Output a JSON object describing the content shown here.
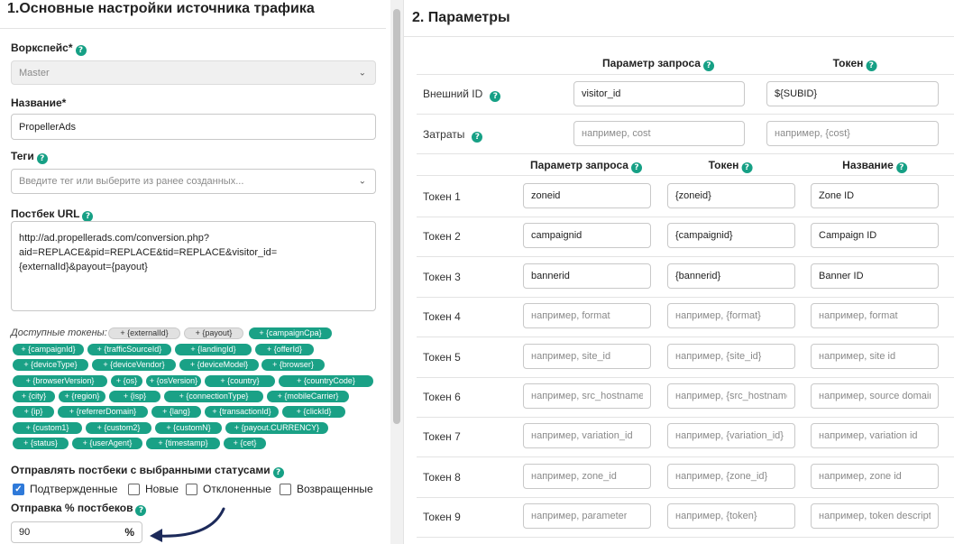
{
  "left": {
    "title": "1.Основные настройки источника трафика",
    "workspace": {
      "label": "Воркспейс*",
      "value": "Master"
    },
    "name": {
      "label": "Название*",
      "value": "PropellerAds"
    },
    "tags": {
      "label": "Теги",
      "placeholder": "Введите тег или выберите из ранее созданных..."
    },
    "postback": {
      "label": "Постбек URL",
      "value": "http://ad.propellerads.com/conversion.php?aid=REPLACE&pid=REPLACE&tid=REPLACE&visitor_id={externalId}&payout={payout}"
    },
    "tokens_label": "Доступные токены:",
    "tokens": [
      "+ {externalId}",
      "+ {payout}",
      "+ {campaignCpa}",
      "+ {campaignId}",
      "+ {trafficSourceId}",
      "+ {landingId}",
      "+ {offerId}",
      "+ {deviceType}",
      "+ {deviceVendor}",
      "+ {deviceModel}",
      "+ {browser}",
      "+ {browserVersion}",
      "+ {os}",
      "+ {osVersion}",
      "+ {country}",
      "+ {countryCode}",
      "+ {city}",
      "+ {region}",
      "+ {isp}",
      "+ {connectionType}",
      "+ {mobileCarrier}",
      "+ {ip}",
      "+ {referrerDomain}",
      "+ {lang}",
      "+ {transactionId}",
      "+ {clickId}",
      "+ {custom1}",
      "+ {custom2}",
      "+ {customN}",
      "+ {payout.CURRENCY}",
      "+ {status}",
      "+ {userAgent}",
      "+ {timestamp}",
      "+ {cet}"
    ],
    "statuses": {
      "label": "Отправлять постбеки с выбранными статусами",
      "options": [
        {
          "label": "Подтвержденные",
          "checked": true
        },
        {
          "label": "Новые",
          "checked": false
        },
        {
          "label": "Отклоненные",
          "checked": false
        },
        {
          "label": "Возвращенные",
          "checked": false
        }
      ]
    },
    "percent": {
      "label": "Отправка % постбеков",
      "value": "90",
      "unit": "%"
    }
  },
  "right": {
    "title": "2. Параметры",
    "head1": {
      "param": "Параметр запроса",
      "token": "Токен"
    },
    "external_id": {
      "label": "Внешний ID",
      "param": "visitor_id",
      "token": "${SUBID}"
    },
    "costs": {
      "label": "Затраты",
      "param_placeholder": "например, cost",
      "token_placeholder": "например, {cost}"
    },
    "head2": {
      "param": "Параметр запроса",
      "token": "Токен",
      "name": "Название"
    },
    "rows": [
      {
        "label": "Токен 1",
        "param": "zoneid",
        "token": "{zoneid}",
        "name": "Zone ID",
        "param_ph": "",
        "token_ph": "",
        "name_ph": ""
      },
      {
        "label": "Токен 2",
        "param": "campaignid",
        "token": "{campaignid}",
        "name": "Campaign ID",
        "param_ph": "",
        "token_ph": "",
        "name_ph": ""
      },
      {
        "label": "Токен 3",
        "param": "bannerid",
        "token": "{bannerid}",
        "name": "Banner ID",
        "param_ph": "",
        "token_ph": "",
        "name_ph": ""
      },
      {
        "label": "Токен 4",
        "param": "",
        "token": "",
        "name": "",
        "param_ph": "например, format",
        "token_ph": "например, {format}",
        "name_ph": "например, format"
      },
      {
        "label": "Токен 5",
        "param": "",
        "token": "",
        "name": "",
        "param_ph": "например, site_id",
        "token_ph": "например, {site_id}",
        "name_ph": "например, site id"
      },
      {
        "label": "Токен 6",
        "param": "",
        "token": "",
        "name": "",
        "param_ph": "например, src_hostname",
        "token_ph": "например, {src_hostname}",
        "name_ph": "например, source domain"
      },
      {
        "label": "Токен 7",
        "param": "",
        "token": "",
        "name": "",
        "param_ph": "например, variation_id",
        "token_ph": "например, {variation_id}",
        "name_ph": "например, variation id"
      },
      {
        "label": "Токен 8",
        "param": "",
        "token": "",
        "name": "",
        "param_ph": "например, zone_id",
        "token_ph": "например, {zone_id}",
        "name_ph": "например, zone id"
      },
      {
        "label": "Токен 9",
        "param": "",
        "token": "",
        "name": "",
        "param_ph": "например, parameter",
        "token_ph": "например, {token}",
        "name_ph": "например, token descriptio"
      }
    ]
  },
  "colors": {
    "accent": "#16a085",
    "chip": "#1aa186",
    "checkbox": "#2f7ad9",
    "arrow": "#1c2a5a"
  },
  "icons": {
    "help": "question-circle-icon",
    "caret": "chevron-down-icon",
    "check": "check-icon",
    "arrow": "curved-arrow-icon"
  }
}
